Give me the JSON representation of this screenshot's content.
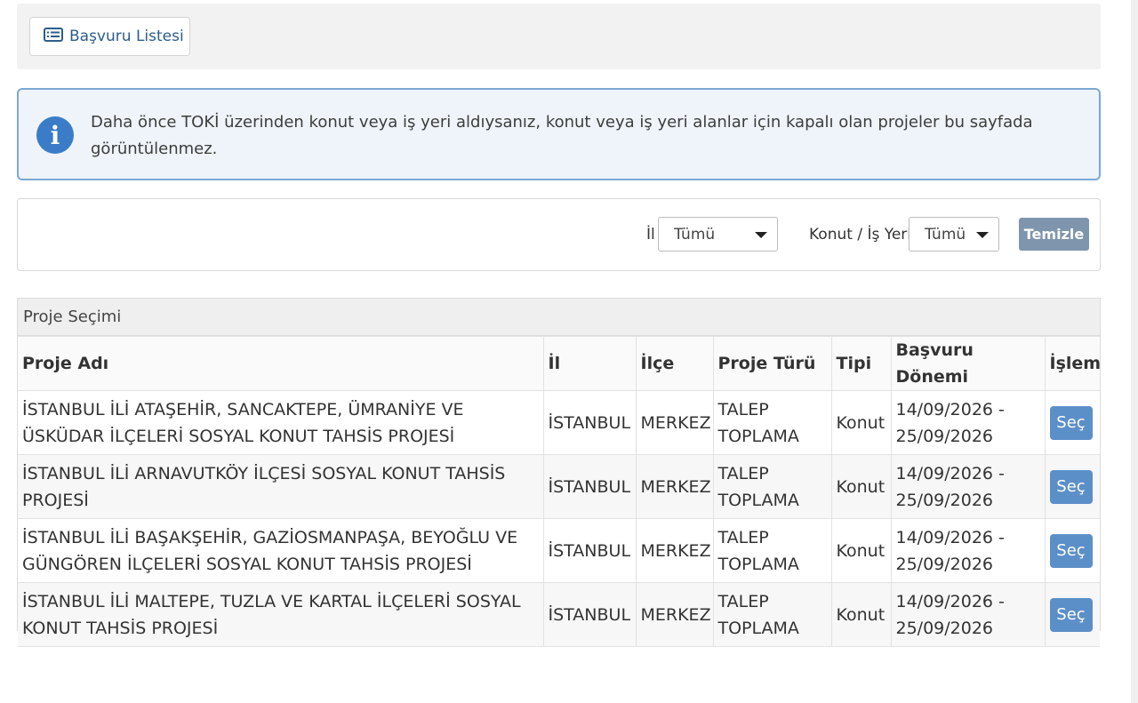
{
  "toolbar": {
    "list_button_label": "Başvuru Listesi",
    "list_icon": "list-icon"
  },
  "info": {
    "icon": "info-icon",
    "icon_glyph": "i",
    "message": "Daha önce TOKİ üzerinden konut veya iş yeri aldıysanız, konut veya iş yeri alanlar için kapalı olan projeler bu sayfada görüntülenmez."
  },
  "filters": {
    "il_label": "İl",
    "il_value": "Tümü",
    "type_label": "Konut / İş Yeri",
    "type_value": "Tümü",
    "clear_label": "Temizle"
  },
  "panel": {
    "title": "Proje Seçimi",
    "columns": [
      "Proje Adı",
      "İl",
      "İlçe",
      "Proje Türü",
      "Tipi",
      "Başvuru Dönemi",
      "İşlem"
    ],
    "rows": [
      {
        "name": "İSTANBUL İLİ ATAŞEHİR, SANCAKTEPE, ÜMRANİYE VE ÜSKÜDAR İLÇELERİ SOSYAL KONUT TAHSİS PROJESİ",
        "il": "İSTANBUL",
        "ilce": "MERKEZ",
        "tur": "TALEP TOPLAMA",
        "tip": "Konut",
        "donem": "14/09/2026 - 25/09/2026",
        "action": "Seç"
      },
      {
        "name": "İSTANBUL İLİ ARNAVUTKÖY İLÇESİ SOSYAL KONUT TAHSİS PROJESİ",
        "il": "İSTANBUL",
        "ilce": "MERKEZ",
        "tur": "TALEP TOPLAMA",
        "tip": "Konut",
        "donem": "14/09/2026 - 25/09/2026",
        "action": "Seç"
      },
      {
        "name": "İSTANBUL İLİ BAŞAKŞEHİR, GAZİOSMANPAŞA, BEYOĞLU VE GÜNGÖREN İLÇELERİ SOSYAL KONUT TAHSİS PROJESİ",
        "il": "İSTANBUL",
        "ilce": "MERKEZ",
        "tur": "TALEP TOPLAMA",
        "tip": "Konut",
        "donem": "14/09/2026 - 25/09/2026",
        "action": "Seç"
      },
      {
        "name": "İSTANBUL İLİ MALTEPE, TUZLA VE KARTAL İLÇELERİ SOSYAL KONUT TAHSİS PROJESİ",
        "il": "İSTANBUL",
        "ilce": "MERKEZ",
        "tur": "TALEP TOPLAMA",
        "tip": "Konut",
        "donem": "14/09/2026 - 25/09/2026",
        "action": "Seç"
      }
    ]
  },
  "colors": {
    "accent": "#5b8fc8",
    "info_border": "#7ba8d2",
    "info_bg": "#eef4f9",
    "clear_button": "#7e95ad"
  }
}
